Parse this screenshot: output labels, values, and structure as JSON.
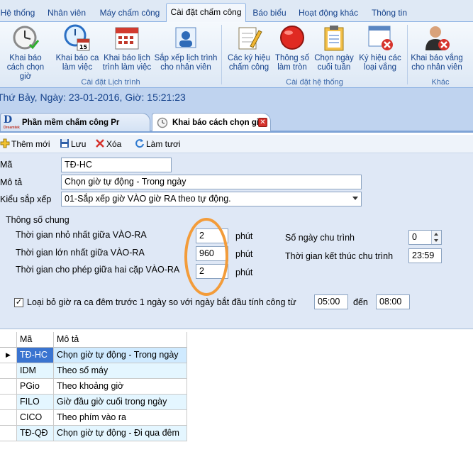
{
  "ribbon_tabs": [
    {
      "label": "Hệ thống",
      "active": false
    },
    {
      "label": "Nhân viên",
      "active": false
    },
    {
      "label": "Máy chấm công",
      "active": false
    },
    {
      "label": "Cài đặt chấm công",
      "active": true
    },
    {
      "label": "Báo biểu",
      "active": false
    },
    {
      "label": "Hoạt động khác",
      "active": false
    },
    {
      "label": "Thông tin",
      "active": false
    }
  ],
  "ribbon_buttons": {
    "khai_bao_cach_chon_gio": "Khai báo cách chọn giờ",
    "khai_bao_ca_lam_viec": "Khai báo ca làm việc",
    "khai_bao_lich_trinh": "Khai báo lịch trình làm việc",
    "sap_xep_lich_trinh": "Sắp xếp lịch trình cho nhân viên",
    "cac_ky_hieu": "Các ký hiệu chấm công",
    "thong_so_lam_tron": "Thông số làm tròn",
    "chon_ngay_cuoi_tuan": "Chọn ngày cuối tuần",
    "ky_hieu_loai_vang": "Ký hiệu các loại vắng",
    "khai_bao_vang": "Khai báo vắng cho nhân viên"
  },
  "ribbon_groups": {
    "lich_trinh": "Cài đặt Lịch trình",
    "he_thong": "Cài đặt hệ thống",
    "khac": "Khác"
  },
  "status_line": "Thứ Bảy, Ngày: 23-01-2016, Giờ: 15:21:23",
  "doc_tabs": {
    "inactive": "Phần mềm chấm công Pr",
    "active": "Khai báo cách chọn giờ",
    "logo_text": "Dreamtek"
  },
  "toolbar": {
    "add": "Thêm mới",
    "save": "Lưu",
    "delete": "Xóa",
    "refresh": "Làm tươi"
  },
  "form": {
    "ma_label": "Mã",
    "ma_value": "TĐ-HC",
    "mota_label": "Mô tả",
    "mota_value": "Chọn giờ tự động - Trong ngày",
    "kieu_label": "Kiểu sắp xếp",
    "kieu_value": "01-Sắp xếp giờ VÀO giờ RA theo tự động.",
    "group_label": "Thông số chung",
    "min_label": "Thời gian nhỏ nhất giữa VÀO-RA",
    "min_value": "2",
    "max_label": "Thời gian lớn nhất giữa VÀO-RA",
    "max_value": "960",
    "pair_label": "Thời gian cho phép giữa hai cặp VÀO-RA",
    "pair_value": "2",
    "unit": "phút",
    "so_ngay_label": "Số ngày chu trình",
    "so_ngay_value": "0",
    "ket_thuc_label": "Thời gian kết thúc chu trình",
    "ket_thuc_value": "23:59",
    "loai_bo_label": "Loại bỏ giờ ra ca đêm trước 1 ngày so với ngày bắt đầu tính công từ",
    "loai_bo_checked": "✓",
    "tu_value": "05:00",
    "den_label": "đến",
    "den_value": "08:00"
  },
  "grid": {
    "headers": {
      "ma": "Mã",
      "mota": "Mô tả"
    },
    "rows": [
      {
        "ma": "TĐ-HC",
        "mota": "Chọn giờ tự động - Trong ngày"
      },
      {
        "ma": "IDM",
        "mota": "Theo số máy"
      },
      {
        "ma": "PGio",
        "mota": "Theo khoảng giờ"
      },
      {
        "ma": "FILO",
        "mota": "Giờ đầu giờ cuối trong ngày"
      },
      {
        "ma": "CICO",
        "mota": "Theo phím vào ra"
      },
      {
        "ma": "TĐ-QĐ",
        "mota": "Chọn giờ tự động - Đi qua đêm"
      }
    ],
    "current_row_marker": "▶"
  },
  "colors": {
    "ribbon_text": "#15428b",
    "selected_cell": "#3a74d0",
    "highlight_ring": "#f39c3a"
  }
}
